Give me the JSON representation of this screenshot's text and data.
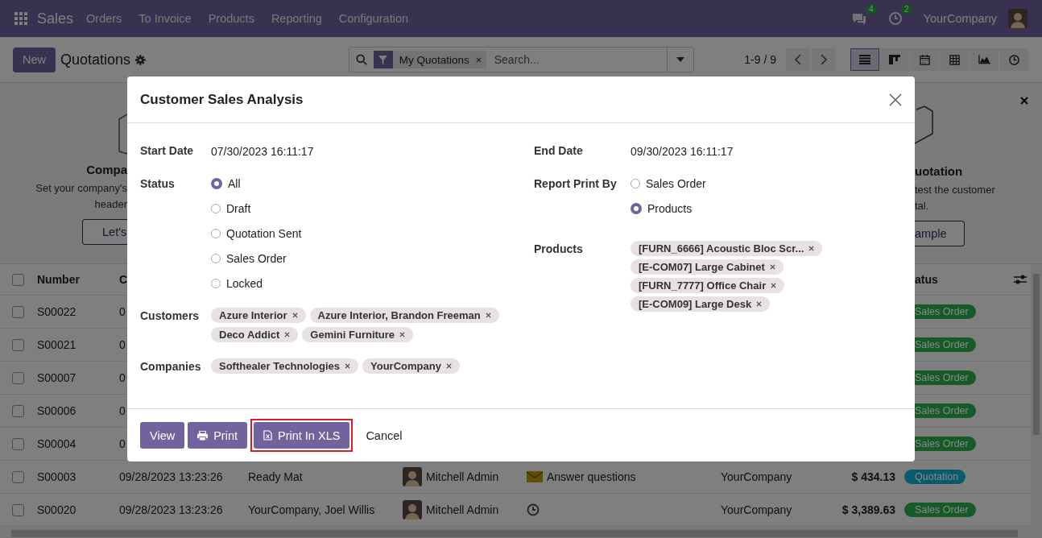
{
  "navbar": {
    "app": "Sales",
    "menu": [
      "Orders",
      "To Invoice",
      "Products",
      "Reporting",
      "Configuration"
    ],
    "messages_count": "4",
    "activities_count": "2",
    "company": "YourCompany"
  },
  "control_panel": {
    "new_button": "New",
    "title": "Quotations",
    "search": {
      "facet": "My Quotations",
      "placeholder": "Search..."
    },
    "pager": "1-9 / 9",
    "views": [
      {
        "kind": "list",
        "selected": true
      },
      {
        "kind": "kanban",
        "selected": false
      },
      {
        "kind": "calendar",
        "selected": false
      },
      {
        "kind": "pivot",
        "selected": false
      },
      {
        "kind": "graph",
        "selected": false
      },
      {
        "kind": "activity",
        "selected": false
      }
    ]
  },
  "banner": {
    "left": {
      "title": "Compa",
      "lines": [
        "Set your company's",
        "header"
      ],
      "button": "Let's"
    },
    "right": {
      "title": "uotation",
      "lines": [
        "test the customer",
        "tal."
      ],
      "button": "ample"
    }
  },
  "list": {
    "select_all_checked": false,
    "columns": [
      "Number",
      "C",
      "atus"
    ],
    "rows": [
      {
        "checked": false,
        "number": "S00022",
        "date": "0",
        "status": {
          "label": "Sales Order",
          "color": "#155a27"
        }
      },
      {
        "checked": false,
        "number": "S00021",
        "date": "0",
        "status": {
          "label": "Sales Order",
          "color": "#155a27"
        }
      },
      {
        "checked": false,
        "number": "S00007",
        "date": "0",
        "status": {
          "label": "Sales Order",
          "color": "#155a27"
        }
      },
      {
        "checked": false,
        "number": "S00006",
        "date": "0",
        "status": {
          "label": "Sales Order",
          "color": "#155a27"
        }
      },
      {
        "checked": false,
        "number": "S00004",
        "date": "0",
        "status": {
          "label": "Sales Order",
          "color": "#155a27"
        }
      },
      {
        "checked": false,
        "number": "S00003",
        "date": "09/28/2023 13:23:26",
        "customer": "Ready Mat",
        "salesperson": "Mitchell Admin",
        "activity": {
          "kind": "email",
          "text": "Answer questions"
        },
        "company": "YourCompany",
        "total": "$ 434.13",
        "status": {
          "label": "Quotation",
          "color": "#0b5a6b"
        }
      },
      {
        "checked": false,
        "number": "S00020",
        "date": "09/28/2023 13:23:26",
        "customer": "YourCompany, Joel Willis",
        "salesperson": "Mitchell Admin",
        "activity": {
          "kind": "clock"
        },
        "company": "YourCompany",
        "total": "$ 3,389.63",
        "status": {
          "label": "Sales Order",
          "color": "#155a27"
        }
      }
    ]
  },
  "dialog": {
    "title": "Customer Sales Analysis",
    "start_date": {
      "label": "Start Date",
      "value": "07/30/2023 16:11:17"
    },
    "status": {
      "label": "Status",
      "options": [
        {
          "label": "All",
          "selected": true
        },
        {
          "label": "Draft",
          "selected": false
        },
        {
          "label": "Quotation Sent",
          "selected": false
        },
        {
          "label": "Sales Order",
          "selected": false
        },
        {
          "label": "Locked",
          "selected": false
        }
      ]
    },
    "customers": {
      "label": "Customers",
      "tags": [
        "Azure Interior",
        "Azure Interior, Brandon Freeman",
        "Deco Addict",
        "Gemini Furniture"
      ]
    },
    "companies": {
      "label": "Companies",
      "tags": [
        "Softhealer Technologies",
        "YourCompany"
      ]
    },
    "end_date": {
      "label": "End Date",
      "value": "09/30/2023 16:11:17"
    },
    "report_print_by": {
      "label": "Report Print By",
      "options": [
        {
          "label": "Sales Order",
          "selected": false
        },
        {
          "label": "Products",
          "selected": true
        }
      ]
    },
    "products": {
      "label": "Products",
      "tags": [
        "[FURN_6666] Acoustic Bloc Scr...",
        "[E-COM07] Large Cabinet",
        "[FURN_7777] Office Chair",
        "[E-COM09] Large Desk"
      ]
    },
    "buttons": [
      {
        "label": "View",
        "kind": "primary",
        "highlighted": false
      },
      {
        "label": "Print",
        "kind": "print",
        "highlighted": false
      },
      {
        "label": "Print In XLS",
        "kind": "xls",
        "highlighted": true
      },
      {
        "label": "Cancel",
        "kind": "link",
        "highlighted": false
      }
    ]
  }
}
